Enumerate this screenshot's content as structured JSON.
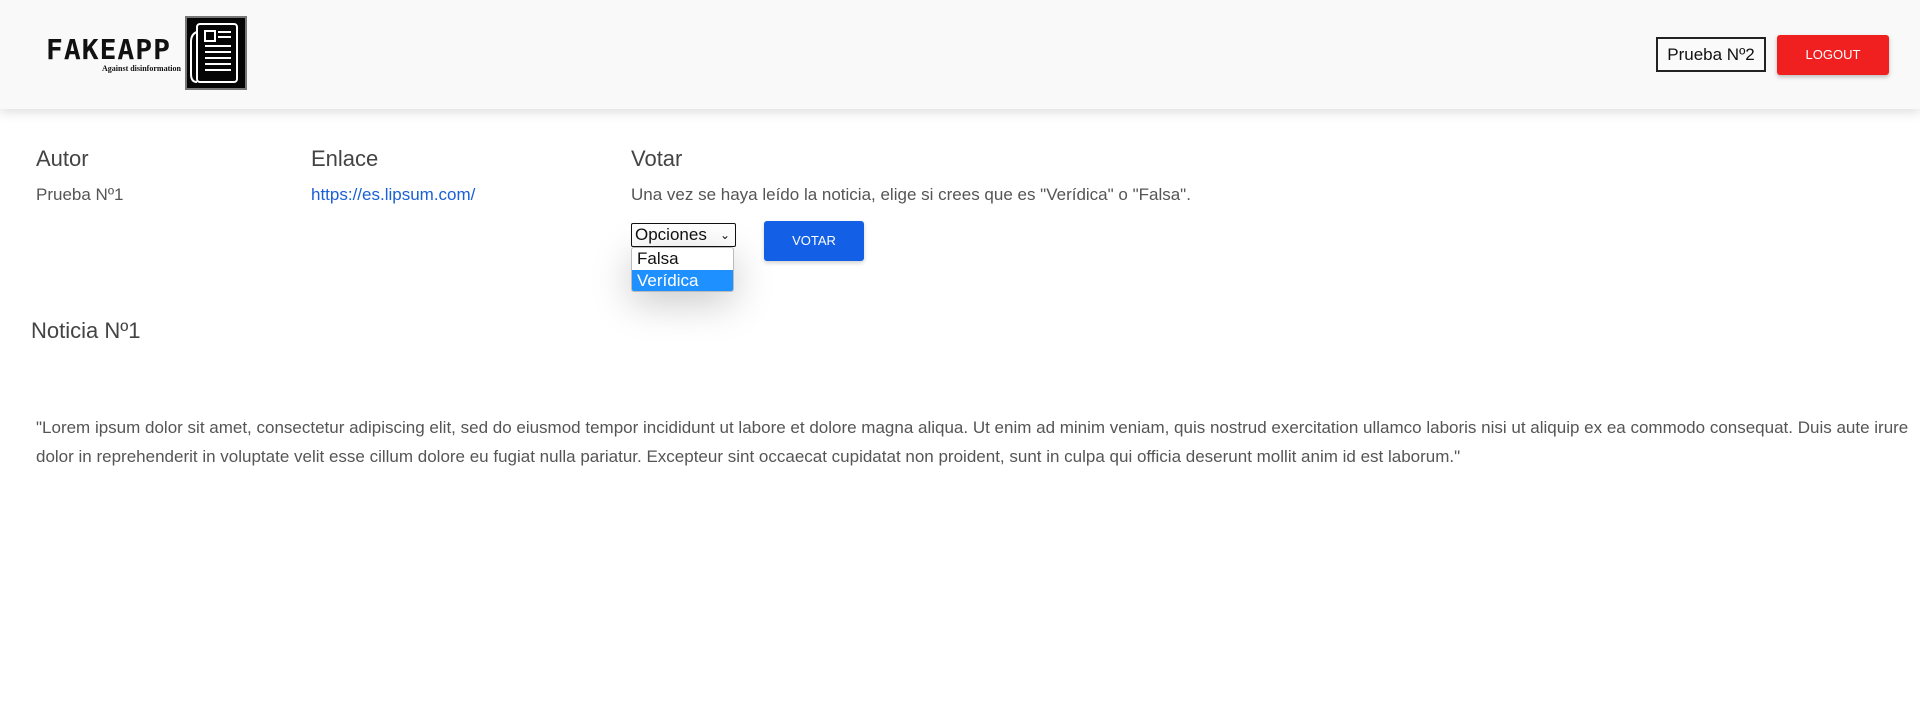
{
  "header": {
    "logo_title": "FAKEAPP",
    "logo_tagline": "Against disinformation",
    "user_label": "Prueba Nº2",
    "logout_label": "LOGOUT"
  },
  "columns": {
    "author_heading": "Autor",
    "author_value": "Prueba Nº1",
    "link_heading": "Enlace",
    "link_value": "https://es.lipsum.com/",
    "vote_heading": "Votar",
    "vote_instructions": "Una vez se haya leído la noticia, elige si crees que es \"Verídica\" o \"Falsa\"."
  },
  "vote": {
    "select_value": "Opciones",
    "options": [
      "Falsa",
      "Verídica"
    ],
    "highlighted_option": "Verídica",
    "submit_label": "VOTAR"
  },
  "news": {
    "title": "Noticia Nº1",
    "body": "\"Lorem ipsum dolor sit amet, consectetur adipiscing elit, sed do eiusmod tempor incididunt ut labore et dolore magna aliqua. Ut enim ad minim veniam, quis nostrud exercitation ullamco laboris nisi ut aliquip ex ea commodo consequat. Duis aute irure dolor in reprehenderit in voluptate velit esse cillum dolore eu fugiat nulla pariatur. Excepteur sint occaecat cupidatat non proident, sunt in culpa qui officia deserunt mollit anim id est laborum.\""
  },
  "colors": {
    "logout": "#f02020",
    "vote_button": "#1360e6",
    "link": "#1a5fd6",
    "option_highlight": "#1e90ff"
  },
  "icons": {
    "logo": "newspaper-icon",
    "select_arrow": "chevron-down-icon"
  }
}
